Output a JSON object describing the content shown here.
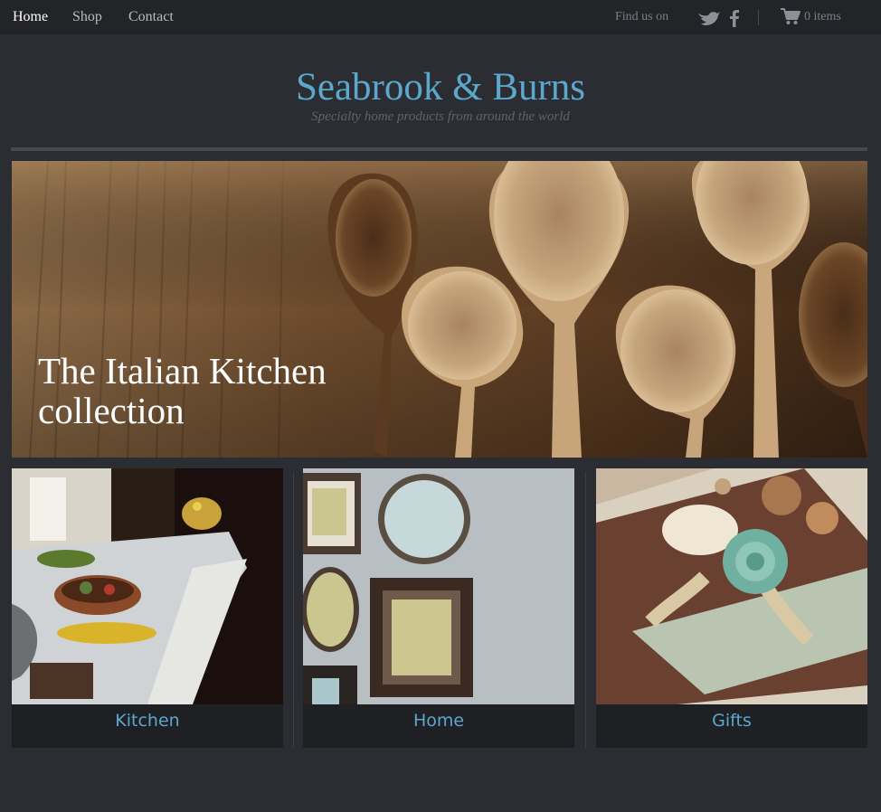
{
  "nav": {
    "links": [
      "Home",
      "Shop",
      "Contact"
    ],
    "find_us": "Find us on",
    "social": [
      "twitter-icon",
      "facebook-icon"
    ],
    "cart": {
      "icon": "cart-icon",
      "count_label": "0 items"
    }
  },
  "header": {
    "title": "Seabrook & Burns",
    "tagline": "Specialty home products from around the world"
  },
  "hero": {
    "caption": "The Italian Kitchen collection"
  },
  "categories": [
    {
      "label": "Kitchen"
    },
    {
      "label": "Home"
    },
    {
      "label": "Gifts"
    }
  ],
  "colors": {
    "page_bg": "#2b2d33",
    "nav_bg": "#232428",
    "accent": "#5ba8cc",
    "tile_bg": "#1f2024"
  }
}
